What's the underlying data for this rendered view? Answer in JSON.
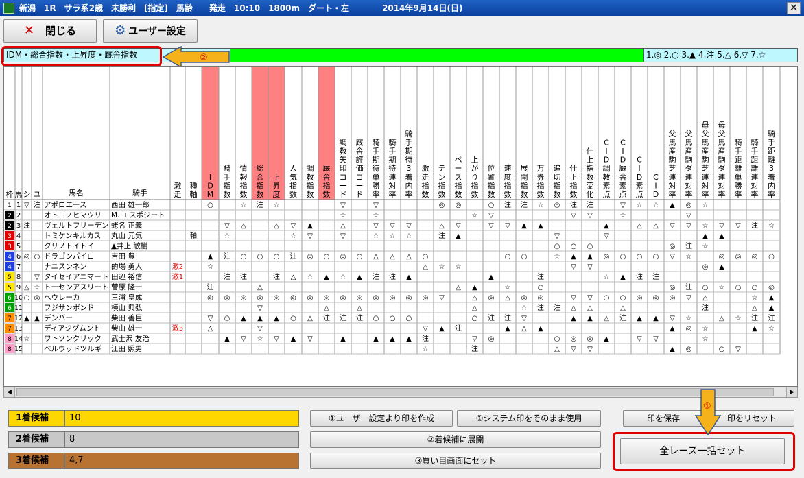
{
  "window": {
    "title": "新潟　1R　サラ系2歳　未勝利　[指定]　馬齢　　発走　10:10　1800m　ダート・左　　　　2014年9月14日(日)",
    "close_label": "×"
  },
  "toolbar": {
    "close_label": "閉じる",
    "user_settings_label": "ユーザー設定"
  },
  "index_bar": {
    "label": "IDM・総合指数・上昇度・厩舎指数",
    "legend": "1.◎ 2.○ 3.▲ 4.注 5.△ 6.▽ 7.☆"
  },
  "annotations": {
    "one": "①",
    "two": "②"
  },
  "colors": {
    "highlight_green": "#00ff00",
    "label_cyan": "#bff7ff",
    "pink_header": "#ff8080",
    "annotation_red": "#e00000",
    "arrow_orange": "#f5b21a"
  },
  "table": {
    "headers": [
      "枠",
      "馬",
      "シ",
      "ユ",
      "馬名",
      "騎手",
      "激走",
      "種軸",
      "IDM",
      "騎手指数",
      "情報指数",
      "総合指数",
      "上昇度",
      "人気指数",
      "調教指数",
      "厩舎指数",
      "調教矢印コード",
      "厩舎評価コード",
      "騎手期待単勝率",
      "騎手期待連対率",
      "騎手期待3着内率",
      "激走指数",
      "テン指数",
      "ペース指数",
      "上がり指数",
      "位置指数",
      "速度指数",
      "展開指数",
      "万券指数",
      "追切指数",
      "仕上指数",
      "仕上指数変化",
      "CID調教素点",
      "CID厩舎素点",
      "CID素点",
      "CID",
      "父馬産駒芝連対率",
      "父馬産駒ダ連対率",
      "母父馬産駒芝連対率",
      "母父馬産駒ダ連対率",
      "騎手距離単勝率",
      "騎手距離連対率",
      "騎手距離3着内率"
    ],
    "rows": [
      [
        "1",
        "1",
        "▽",
        "注",
        "アポロエース",
        "西田 雄一郎",
        "",
        "",
        "○",
        "",
        "☆",
        "注",
        "☆",
        "",
        "",
        "",
        "▽",
        "",
        "▽",
        "",
        "",
        "",
        "◎",
        "◎",
        "",
        "○",
        "注",
        "注",
        "☆",
        "◎",
        "注",
        "注",
        "",
        "▽",
        "☆",
        "☆",
        "▲",
        "◎",
        "☆",
        "",
        "",
        "",
        ""
      ],
      [
        "2",
        "2",
        "",
        "",
        "オトコノヒマツリ",
        "M. エスポジート",
        "",
        "",
        "",
        "",
        "",
        "",
        "",
        "",
        "",
        "",
        "☆",
        "",
        "☆",
        "",
        "",
        "",
        "",
        "",
        "☆",
        "▽",
        "",
        "",
        "",
        "",
        "▽",
        "▽",
        "",
        "☆",
        "",
        "",
        "",
        "▽",
        "",
        "",
        "",
        "",
        ""
      ],
      [
        "2",
        "3",
        "注",
        "",
        "ヴェルトフリーデン",
        "蛯名 正義",
        "",
        "",
        "",
        "▽",
        "△",
        "",
        "△",
        "▽",
        "▲",
        "",
        "△",
        "",
        "▽",
        "▽",
        "▽",
        "",
        "△",
        "▽",
        "",
        "▽",
        "▽",
        "▲",
        "▲",
        "",
        "",
        "",
        "▲",
        "",
        "△",
        "△",
        "▽",
        "▽",
        "☆",
        "▽",
        "▽",
        "注",
        "☆"
      ],
      [
        "3",
        "4",
        "",
        "",
        "トミケンキルカス",
        "丸山 元気",
        "",
        "軸",
        "",
        "☆",
        "",
        "",
        "",
        "☆",
        "▽",
        "",
        "▽",
        "",
        "☆",
        "☆",
        "☆",
        "",
        "注",
        "▲",
        "",
        "",
        "",
        "",
        "",
        "▽",
        "",
        "",
        "▽",
        "",
        "",
        "",
        "",
        "",
        "▲",
        "▲",
        "",
        "",
        ""
      ],
      [
        "3",
        "5",
        "",
        "",
        "クリノトイトイ",
        "▲井上 敏樹",
        "",
        "",
        "",
        "",
        "",
        "",
        "",
        "",
        "",
        "",
        "",
        "",
        "",
        "",
        "",
        "",
        "",
        "",
        "",
        "",
        "",
        "",
        "",
        "○",
        "○",
        "○",
        "",
        "",
        "",
        "",
        "◎",
        "注",
        "☆",
        "",
        "",
        "",
        ""
      ],
      [
        "4",
        "6",
        "◎",
        "○",
        "ドラゴンパイロ",
        "吉田 豊",
        "",
        "",
        "▲",
        "注",
        "○",
        "○",
        "○",
        "注",
        "◎",
        "○",
        "◎",
        "○",
        "△",
        "△",
        "△",
        "○",
        "",
        "",
        "",
        "",
        "○",
        "○",
        "",
        "☆",
        "▲",
        "▲",
        "◎",
        "○",
        "○",
        "○",
        "▽",
        "☆",
        "",
        "◎",
        "◎",
        "◎",
        "○"
      ],
      [
        "4",
        "7",
        "",
        "",
        "ナニスンネン",
        "的場 勇人",
        "激2",
        "",
        "☆",
        "",
        "",
        "",
        "",
        "",
        "",
        "",
        "",
        "",
        "",
        "",
        "",
        "△",
        "☆",
        "☆",
        "",
        "",
        "",
        "",
        "",
        "",
        "▽",
        "▽",
        "",
        "",
        "",
        "",
        "",
        "",
        "◎",
        "▲",
        "",
        "",
        ""
      ],
      [
        "5",
        "8",
        "",
        "▽",
        "タイセイアニマート",
        "田辺 裕信",
        "激1",
        "",
        "",
        "注",
        "注",
        "",
        "注",
        "△",
        "☆",
        "▲",
        "☆",
        "▲",
        "注",
        "注",
        "▲",
        "",
        "",
        "",
        "",
        "▲",
        "",
        "",
        "注",
        "",
        "",
        "",
        "☆",
        "▲",
        "注",
        "注",
        "",
        "",
        "",
        "",
        "",
        "",
        ""
      ],
      [
        "5",
        "9",
        "△",
        "☆",
        "トーセンアスリート",
        "菅原 隆一",
        "",
        "",
        "注",
        "",
        "",
        "△",
        "",
        "",
        "",
        "",
        "",
        "",
        "",
        "",
        "",
        "",
        "",
        "△",
        "▲",
        "",
        "☆",
        "",
        "○",
        "",
        "",
        "",
        "",
        "",
        "",
        "",
        "◎",
        "注",
        "○",
        "☆",
        "○",
        "○",
        "◎"
      ],
      [
        "6",
        "10",
        "○",
        "◎",
        "ヘウレーカ",
        "三浦 皇成",
        "",
        "",
        "◎",
        "◎",
        "◎",
        "◎",
        "◎",
        "◎",
        "◎",
        "◎",
        "◎",
        "◎",
        "◎",
        "◎",
        "◎",
        "◎",
        "▽",
        "",
        "△",
        "◎",
        "△",
        "◎",
        "◎",
        "",
        "▽",
        "▽",
        "○",
        "○",
        "◎",
        "◎",
        "◎",
        "▽",
        "△",
        "",
        "",
        "☆",
        "▲"
      ],
      [
        "6",
        "11",
        "",
        "",
        "フジサンボンド",
        "横山 典弘",
        "",
        "",
        "",
        "",
        "",
        "▽",
        "",
        "",
        "",
        "△",
        "",
        "△",
        "",
        "",
        "",
        "",
        "",
        "",
        "△",
        "",
        "",
        "☆",
        "注",
        "注",
        "△",
        "△",
        "",
        "△",
        "",
        "",
        "",
        "",
        "注",
        "",
        "",
        "△",
        "▲"
      ],
      [
        "7",
        "12",
        "▲",
        "▲",
        "デンバー",
        "柴田 善臣",
        "",
        "",
        "▽",
        "○",
        "▲",
        "▲",
        "▲",
        "○",
        "△",
        "注",
        "注",
        "注",
        "○",
        "○",
        "○",
        "",
        "",
        "",
        "○",
        "注",
        "注",
        "▽",
        "",
        "",
        "▲",
        "▲",
        "△",
        "注",
        "▲",
        "▲",
        "▽",
        "☆",
        "",
        "△",
        "☆",
        "注",
        "注"
      ],
      [
        "7",
        "13",
        "",
        "",
        "ディアジグムント",
        "柴山 雄一",
        "激3",
        "",
        "△",
        "",
        "",
        "▽",
        "",
        "",
        "",
        "",
        "",
        "",
        "",
        "",
        "",
        "▽",
        "▲",
        "注",
        "",
        "",
        "▲",
        "△",
        "▲",
        "",
        "",
        "",
        "",
        "",
        "",
        "",
        "▲",
        "◎",
        "☆",
        "",
        "",
        "▲",
        "☆"
      ],
      [
        "8",
        "14",
        "☆",
        "",
        "ワトソンクリック",
        "武士沢 友治",
        "",
        "",
        "",
        "▲",
        "▽",
        "☆",
        "▽",
        "▲",
        "▽",
        "",
        "▲",
        "",
        "▲",
        "▲",
        "▲",
        "注",
        "",
        "",
        "▽",
        "◎",
        "",
        "",
        "",
        "○",
        "◎",
        "◎",
        "▲",
        "",
        "▽",
        "▽",
        "",
        "",
        "☆",
        "",
        "",
        "",
        ""
      ],
      [
        "8",
        "15",
        "",
        "",
        "ベルウッドツルギ",
        "江田 照男",
        "",
        "",
        "",
        "",
        "",
        "",
        "",
        "",
        "",
        "",
        "",
        "",
        "",
        "",
        "",
        "☆",
        "",
        "",
        "注",
        "",
        "",
        "",
        "",
        "△",
        "▽",
        "▽",
        "",
        "",
        "",
        "",
        "▲",
        "◎",
        "",
        "○",
        "▽",
        "",
        ""
      ]
    ]
  },
  "candidates": [
    {
      "label": "1着候補",
      "value": "10",
      "color": "#ffd700"
    },
    {
      "label": "2着候補",
      "value": "8",
      "color": "#c8c8c8"
    },
    {
      "label": "3着候補",
      "value": "4,7",
      "color": "#b87333"
    }
  ],
  "actions": {
    "mark_from_user": "①ユーザー設定より印を作成",
    "use_system_mark": "①システム印をそのまま使用",
    "save_mark": "印を保存",
    "reset_mark": "印をリセット",
    "expand_to_2nd": "②着候補に展開",
    "set_to_bet": "③買い目画面にセット",
    "all_race_set": "全レース一括セット"
  }
}
